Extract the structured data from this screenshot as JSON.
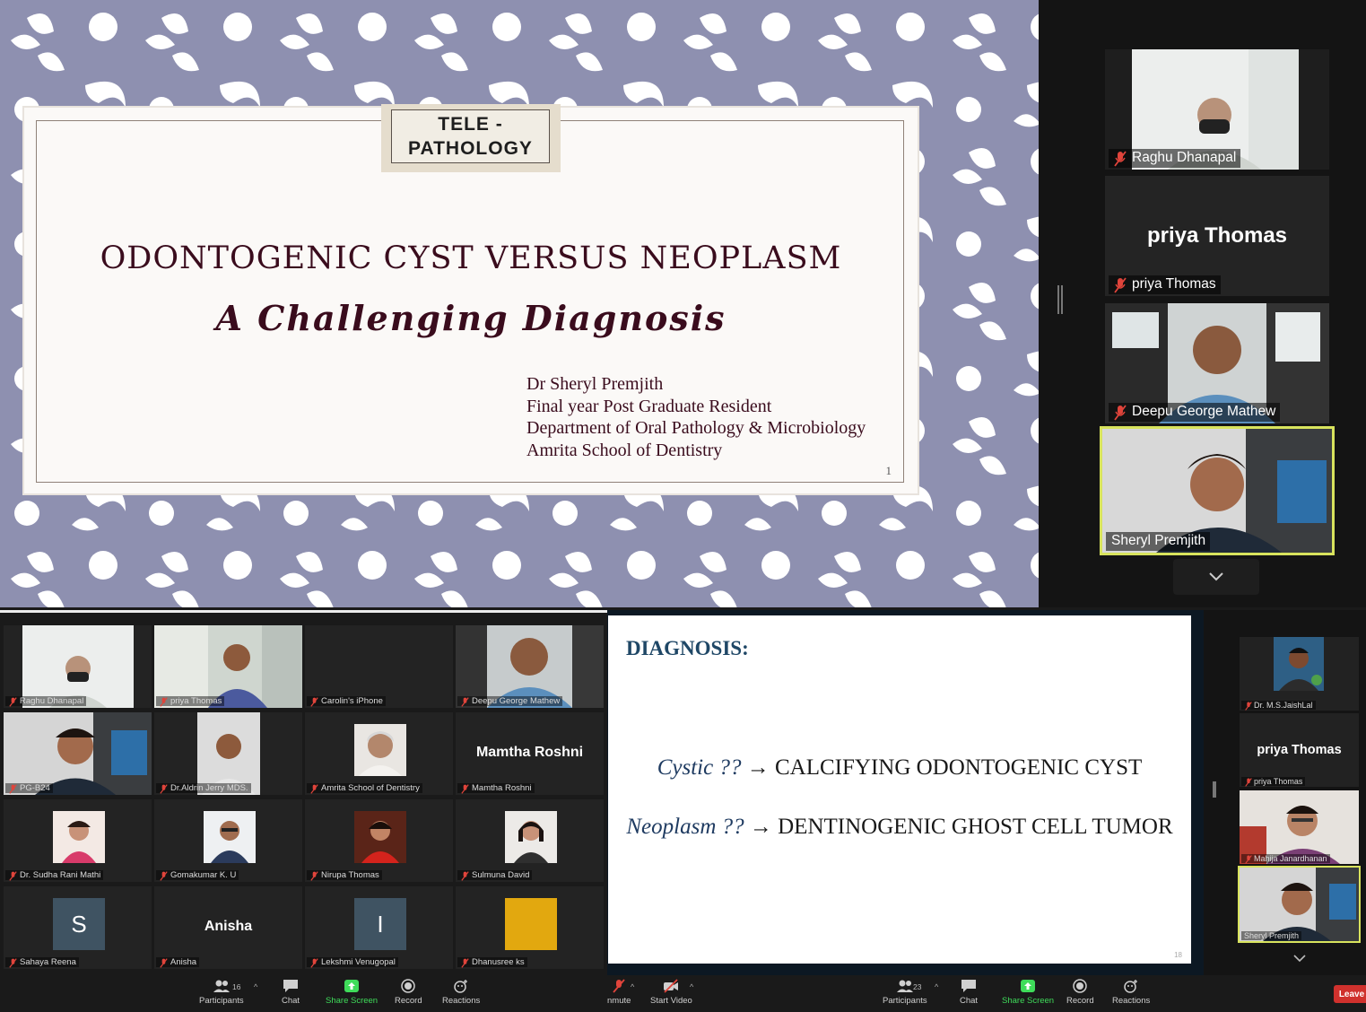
{
  "top_slide": {
    "tag_line1": "TELE -",
    "tag_line2": "PATHOLOGY",
    "title": "ODONTOGENIC CYST VERSUS NEOPLASM",
    "subtitle": "A Challenging Diagnosis",
    "author": [
      "Dr Sheryl Premjith",
      "Final year Post Graduate Resident",
      "Department of Oral Pathology & Microbiology",
      "Amrita School of Dentistry"
    ],
    "page_number": "1"
  },
  "top_panel": {
    "tiles": [
      {
        "label": "Raghu Dhanapal",
        "big_name": "",
        "muted": true
      },
      {
        "label": "priya Thomas",
        "big_name": "priya Thomas",
        "muted": true
      },
      {
        "label": "Deepu George Mathew",
        "big_name": "",
        "muted": true
      },
      {
        "label": "Sheryl Premjith",
        "big_name": "",
        "muted": false
      }
    ],
    "more_icon": "chevron-down-icon"
  },
  "gallery": {
    "tiles": [
      {
        "label": "Raghu Dhanapal",
        "name": "",
        "letter": ""
      },
      {
        "label": "priya Thomas",
        "name": "",
        "letter": ""
      },
      {
        "label": "Carolin's iPhone",
        "name": "",
        "letter": ""
      },
      {
        "label": "Deepu George Mathew",
        "name": "",
        "letter": ""
      },
      {
        "label": "PG-B24",
        "name": "",
        "letter": ""
      },
      {
        "label": "Dr.Aldrin Jerry MDS.",
        "name": "",
        "letter": ""
      },
      {
        "label": "Amrita School of Dentistry",
        "name": "",
        "letter": ""
      },
      {
        "label": "Mamtha Roshni",
        "name": "Mamtha Roshni",
        "letter": ""
      },
      {
        "label": "Dr. Sudha Rani Mathi",
        "name": "",
        "letter": ""
      },
      {
        "label": "Gomakumar K. U",
        "name": "",
        "letter": ""
      },
      {
        "label": "Nirupa Thomas",
        "name": "",
        "letter": ""
      },
      {
        "label": "Sulmuna David",
        "name": "",
        "letter": ""
      },
      {
        "label": "Sahaya Reena",
        "name": "",
        "letter": "S"
      },
      {
        "label": "Anisha",
        "name": "Anisha",
        "letter": ""
      },
      {
        "label": "Lekshmi Venugopal",
        "name": "",
        "letter": "I"
      },
      {
        "label": "Dhanusree ks",
        "name": "",
        "letter": ""
      }
    ]
  },
  "toolbar_left": {
    "participants": "Participants",
    "participants_count": "16",
    "chat": "Chat",
    "share": "Share Screen",
    "record": "Record",
    "reactions": "Reactions"
  },
  "bottom_slide": {
    "heading": "DIAGNOSIS:",
    "line1_italic": "Cystic ??",
    "line1_text": "CALCIFYING ODONTOGENIC CYST",
    "line2_italic": "Neoplasm ??",
    "line2_text": "DENTINOGENIC GHOST CELL TUMOR",
    "arrow": "→",
    "page_number": "18"
  },
  "side_panel": {
    "tiles": [
      {
        "label": "Dr. M.S.JaishLal",
        "name": ""
      },
      {
        "label": "priya Thomas",
        "name": "priya Thomas"
      },
      {
        "label": "Mahija Janardhanan",
        "name": ""
      },
      {
        "label": "Sheryl Premjith",
        "name": ""
      }
    ]
  },
  "toolbar_right": {
    "unmute": "nmute",
    "start_video": "Start Video",
    "participants": "Participants",
    "participants_count": "23",
    "chat": "Chat",
    "share": "Share Screen",
    "record": "Record",
    "reactions": "Reactions",
    "leave": "Leave"
  },
  "colors": {
    "slide_bg": "#8e90b0",
    "slide_text": "#3a0c1d",
    "active_speaker": "#d8e35d",
    "share_green": "#3fdc5a",
    "leave_red": "#d0312d",
    "diagnosis_blue": "#1f4766"
  }
}
